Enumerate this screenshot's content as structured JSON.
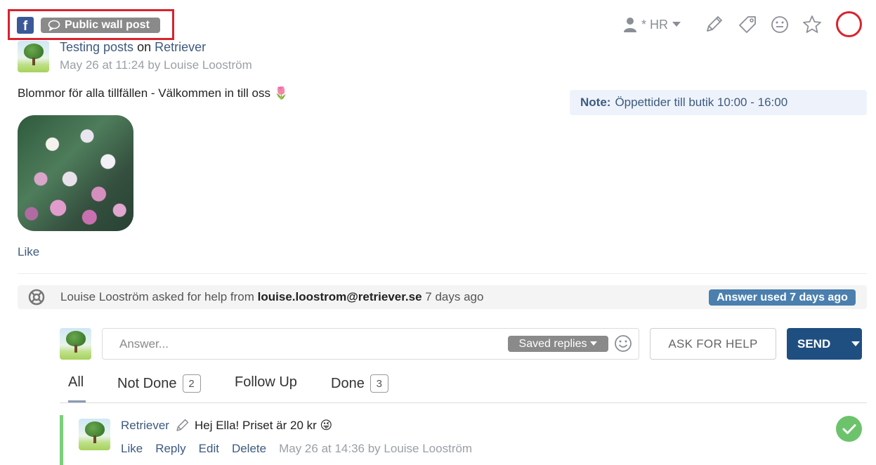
{
  "header": {
    "network": "f",
    "post_type": "Public wall post",
    "assignee": "* HR",
    "icons": [
      "user-icon",
      "caret-down-icon",
      "pencil-icon",
      "tag-icon",
      "smiley-icon",
      "star-icon",
      "status-ring-icon"
    ],
    "status_color": "#d9232d"
  },
  "post": {
    "title_link": "Testing posts",
    "title_on": "on",
    "page_link": "Retriever",
    "meta": "May 26 at 11:24 by Louise Looström",
    "text": "Blommor för alla tillfällen - Välkommen in till oss 🌷",
    "like": "Like"
  },
  "note": {
    "label": "Note:",
    "text": "Öppettider till butik 10:00 - 16:00"
  },
  "help": {
    "prefix": "Louise Looström asked for help from",
    "email": "louise.loostrom@retriever.se",
    "when": "7 days ago",
    "badge": "Answer used 7 days ago"
  },
  "reply": {
    "placeholder": "Answer...",
    "saved_replies": "Saved replies",
    "ask_for_help": "ASK FOR HELP",
    "send": "SEND"
  },
  "tabs": [
    {
      "label": "All",
      "count": ""
    },
    {
      "label": "Not Done",
      "count": "2"
    },
    {
      "label": "Follow Up",
      "count": ""
    },
    {
      "label": "Done",
      "count": "3"
    }
  ],
  "comment": {
    "author": "Retriever",
    "text": "Hej Ella! Priset är 20 kr 😜",
    "actions": [
      "Like",
      "Reply",
      "Edit",
      "Delete"
    ],
    "meta": "May 26 at 14:36 by Louise Looström"
  },
  "colors": {
    "accent": "#1f4f80",
    "link": "#3d5a80",
    "done": "#6cc36c"
  }
}
